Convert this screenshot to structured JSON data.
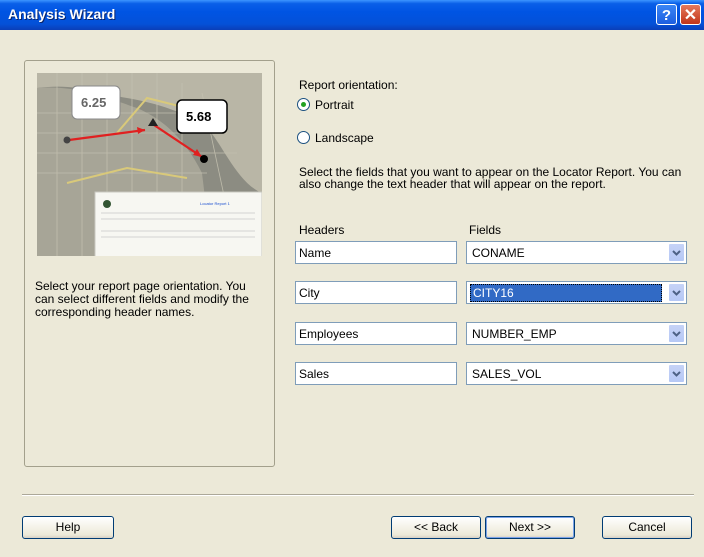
{
  "window": {
    "title": "Analysis Wizard",
    "help_glyph": "?",
    "close_glyph": "✕"
  },
  "left": {
    "description": "Select your report page orientation. You can select different fields and modify the corresponding header names.",
    "map": {
      "label_left": "6.25",
      "label_right": "5.68",
      "report_title": "Locator Report 1"
    }
  },
  "orientation": {
    "label": "Report orientation:",
    "options": [
      {
        "label": "Portrait",
        "selected": true
      },
      {
        "label": "Landscape",
        "selected": false
      }
    ]
  },
  "fields_instructions": "Select the fields that you want to appear on the Locator Report. You can also change the text header that will appear on the report.",
  "columns": {
    "headers": "Headers",
    "fields": "Fields"
  },
  "rows": [
    {
      "header": "Name",
      "field": "CONAME",
      "focused": false
    },
    {
      "header": "City",
      "field": "CITY16",
      "focused": true
    },
    {
      "header": "Employees",
      "field": "NUMBER_EMP",
      "focused": false
    },
    {
      "header": "Sales",
      "field": "SALES_VOL",
      "focused": false
    }
  ],
  "buttons": {
    "help": "Help",
    "back": "<< Back",
    "next": "Next >>",
    "cancel": "Cancel"
  },
  "colors": {
    "titlebar": "#0054e3",
    "dialog_bg": "#ece9d8",
    "selection": "#316ac5",
    "radio_dot": "#21a121"
  }
}
